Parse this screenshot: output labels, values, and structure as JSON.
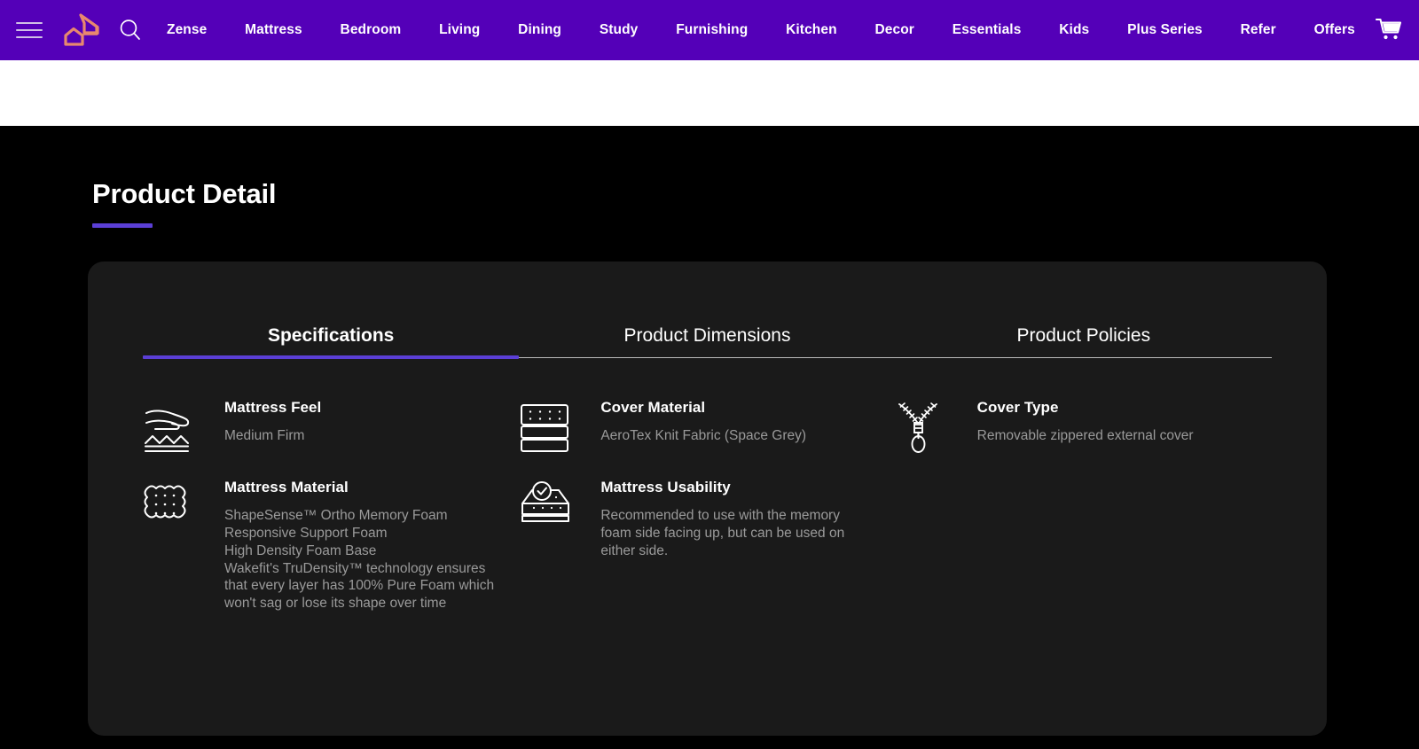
{
  "nav": {
    "menu_icon": "hamburger-menu-icon",
    "logo_alt": "wakefit-house-logo",
    "search_icon": "search-icon",
    "cart_icon": "shopping-cart-icon",
    "brand_color": "#5400b8",
    "logo_color": "#e8886e",
    "links": [
      {
        "label": "Zense"
      },
      {
        "label": "Mattress"
      },
      {
        "label": "Bedroom"
      },
      {
        "label": "Living"
      },
      {
        "label": "Dining"
      },
      {
        "label": "Study"
      },
      {
        "label": "Furnishing"
      },
      {
        "label": "Kitchen"
      },
      {
        "label": "Decor"
      },
      {
        "label": "Essentials"
      },
      {
        "label": "Kids"
      },
      {
        "label": "Plus Series"
      },
      {
        "label": "Refer"
      },
      {
        "label": "Offers"
      }
    ]
  },
  "section": {
    "heading": "Product Detail",
    "accent_color": "#5b3fd6",
    "background_color": "#000000",
    "card_color": "#1a1a1a"
  },
  "tabs": [
    {
      "label": "Specifications",
      "active": true
    },
    {
      "label": "Product Dimensions",
      "active": false
    },
    {
      "label": "Product Policies",
      "active": false
    }
  ],
  "specs": [
    {
      "icon": "hand-pressing-mattress-icon",
      "title": "Mattress Feel",
      "value": "Medium Firm"
    },
    {
      "icon": "layered-mattress-icon",
      "title": "Cover Material",
      "value": "AeroTex Knit Fabric (Space Grey)"
    },
    {
      "icon": "zipper-icon",
      "title": "Cover Type",
      "value": "Removable zippered external cover"
    },
    {
      "icon": "foam-block-icon",
      "title": "Mattress Material",
      "value": "ShapeSense™ Ortho Memory Foam\nResponsive Support Foam\nHigh Density Foam Base\nWakefit's TruDensity™ technology ensures that every layer has 100% Pure Foam which won't sag or lose its shape over time"
    },
    {
      "icon": "mattress-check-icon",
      "title": "Mattress Usability",
      "value": "Recommended to use with the memory foam side facing up, but can be used on either side."
    }
  ]
}
